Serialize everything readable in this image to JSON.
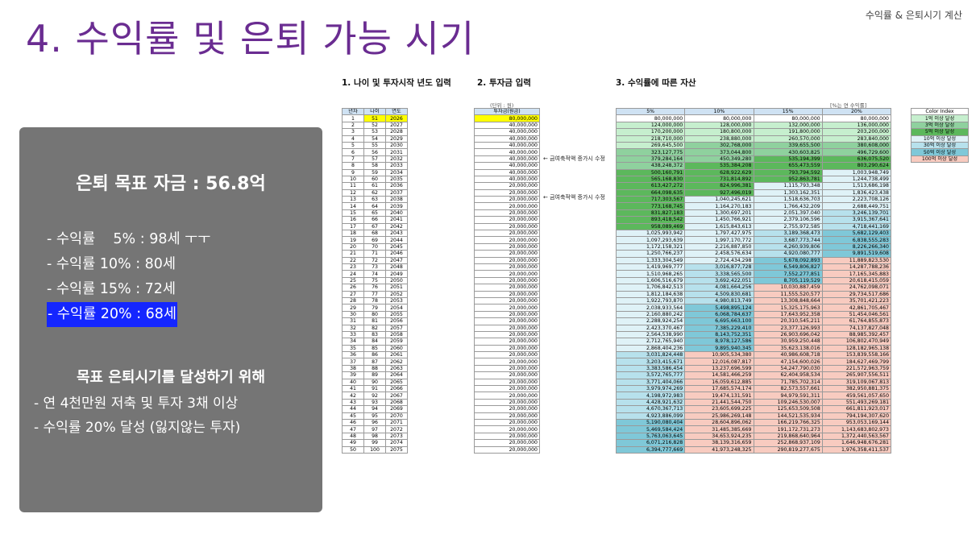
{
  "header": {
    "top_right_label": "수익률 & 은퇴시기 계산",
    "title": "4. 수익률 및 은퇴 가능 시기"
  },
  "panel": {
    "goal": "은퇴 목표 자금 : 56.8억",
    "rates": [
      "- 수익률    5% : 98세 ㅜㅜ",
      "- 수익률 10% : 80세",
      "- 수익률 15% : 72세",
      "- 수익률 20% : 68세"
    ],
    "selected_index": 3,
    "condition_title": "목표 은퇴시기를 달성하기 위해",
    "conditions": [
      "- 연 4천만원 저축 및 투자 3채 이상",
      "- 수익률 20% 달성 (잃지않는 투자)"
    ]
  },
  "sheet": {
    "section1_label": "1. 나이 및 투자시작 년도 입력",
    "section2_label": "2. 투자금 입력",
    "section3_label": "3. 수익률에 따른 자산",
    "unit_note": "(단위 : 원)",
    "rate_note": "[%는 연 수익률]",
    "change_note": "← 금여축적액 증가시 수정",
    "headers1": [
      "년차",
      "나이",
      "연도"
    ],
    "header2": "투자금(원금)",
    "headers3": [
      "5%",
      "10%",
      "15%",
      "20%"
    ],
    "legend_title": "Color Index",
    "legend": [
      {
        "label": "1억 이상 달성",
        "color": "#c6efce"
      },
      {
        "label": "3억 이상 달성",
        "color": "#8fd19e"
      },
      {
        "label": "5억 이상 달성",
        "color": "#5cb85c"
      },
      {
        "label": "10억 이상 달성",
        "color": "#dff2f7"
      },
      {
        "label": "30억 이상 달성",
        "color": "#b7e1ec"
      },
      {
        "label": "50억 이상 달성",
        "color": "#7fc8d8"
      },
      {
        "label": "100억 이상 달성",
        "color": "#f8cbc0"
      }
    ],
    "rows": [
      [
        "1",
        "51",
        "2026",
        "80,000,000",
        "80,000,000",
        "80,000,000",
        "80,000,000",
        "80,000,000"
      ],
      [
        "2",
        "52",
        "2027",
        "40,000,000",
        "124,000,000",
        "128,000,000",
        "132,000,000",
        "136,000,000"
      ],
      [
        "3",
        "53",
        "2028",
        "40,000,000",
        "170,200,000",
        "180,800,000",
        "191,800,000",
        "203,200,000"
      ],
      [
        "4",
        "54",
        "2029",
        "40,000,000",
        "218,710,000",
        "238,880,000",
        "260,570,000",
        "283,840,000"
      ],
      [
        "5",
        "55",
        "2030",
        "40,000,000",
        "269,645,500",
        "302,768,000",
        "339,655,500",
        "380,608,000"
      ],
      [
        "6",
        "56",
        "2031",
        "40,000,000",
        "323,127,775",
        "373,044,800",
        "430,603,825",
        "496,729,600"
      ],
      [
        "7",
        "57",
        "2032",
        "40,000,000",
        "379,284,164",
        "450,349,280",
        "535,194,399",
        "636,075,520"
      ],
      [
        "8",
        "58",
        "2033",
        "40,000,000",
        "438,248,372",
        "535,384,208",
        "655,473,559",
        "803,290,624"
      ],
      [
        "9",
        "59",
        "2034",
        "40,000,000",
        "500,160,791",
        "628,922,629",
        "793,794,592",
        "1,003,948,749"
      ],
      [
        "10",
        "60",
        "2035",
        "40,000,000",
        "565,168,830",
        "731,814,892",
        "952,863,781",
        "1,244,738,499"
      ],
      [
        "11",
        "61",
        "2036",
        "20,000,000",
        "613,427,272",
        "824,996,381",
        "1,115,793,348",
        "1,513,686,198"
      ],
      [
        "12",
        "62",
        "2037",
        "20,000,000",
        "664,098,635",
        "927,496,019",
        "1,303,162,351",
        "1,836,423,438"
      ],
      [
        "13",
        "63",
        "2038",
        "20,000,000",
        "717,303,567",
        "1,040,245,621",
        "1,518,636,703",
        "2,223,708,126"
      ],
      [
        "14",
        "64",
        "2039",
        "20,000,000",
        "773,168,745",
        "1,164,270,183",
        "1,766,432,209",
        "2,688,449,751"
      ],
      [
        "15",
        "65",
        "2040",
        "20,000,000",
        "831,827,183",
        "1,300,697,201",
        "2,051,397,040",
        "3,246,139,701"
      ],
      [
        "16",
        "66",
        "2041",
        "20,000,000",
        "893,418,542",
        "1,450,766,921",
        "2,379,106,596",
        "3,915,367,641"
      ],
      [
        "17",
        "67",
        "2042",
        "20,000,000",
        "958,089,469",
        "1,615,843,613",
        "2,755,972,585",
        "4,718,441,169"
      ],
      [
        "18",
        "68",
        "2043",
        "20,000,000",
        "1,025,993,942",
        "1,797,427,975",
        "3,189,368,473",
        "5,682,129,403"
      ],
      [
        "19",
        "69",
        "2044",
        "20,000,000",
        "1,097,293,639",
        "1,997,170,772",
        "3,687,773,744",
        "6,838,555,283"
      ],
      [
        "20",
        "70",
        "2045",
        "20,000,000",
        "1,172,158,321",
        "2,216,887,850",
        "4,260,939,806",
        "8,226,266,340"
      ],
      [
        "21",
        "71",
        "2046",
        "20,000,000",
        "1,250,766,237",
        "2,458,576,634",
        "4,920,080,777",
        "9,891,519,608"
      ],
      [
        "22",
        "72",
        "2047",
        "20,000,000",
        "1,333,304,549",
        "2,724,434,298",
        "5,678,092,893",
        "11,889,823,530"
      ],
      [
        "23",
        "73",
        "2048",
        "20,000,000",
        "1,419,969,777",
        "3,016,877,728",
        "6,549,806,827",
        "14,287,788,236"
      ],
      [
        "24",
        "74",
        "2049",
        "20,000,000",
        "1,510,968,265",
        "3,338,565,500",
        "7,552,277,851",
        "17,165,345,883"
      ],
      [
        "25",
        "75",
        "2050",
        "20,000,000",
        "1,606,516,679",
        "3,692,422,051",
        "8,705,119,529",
        "20,618,415,059"
      ],
      [
        "26",
        "76",
        "2051",
        "20,000,000",
        "1,706,842,513",
        "4,081,664,256",
        "10,030,887,459",
        "24,762,098,071"
      ],
      [
        "27",
        "77",
        "2052",
        "20,000,000",
        "1,812,184,638",
        "4,509,830,681",
        "11,555,520,577",
        "29,734,517,686"
      ],
      [
        "28",
        "78",
        "2053",
        "20,000,000",
        "1,922,793,870",
        "4,980,813,749",
        "13,308,848,664",
        "35,701,421,223"
      ],
      [
        "29",
        "79",
        "2054",
        "20,000,000",
        "2,038,933,564",
        "5,498,895,124",
        "15,325,175,963",
        "42,861,705,467"
      ],
      [
        "30",
        "80",
        "2055",
        "20,000,000",
        "2,160,880,242",
        "6,068,784,637",
        "17,643,952,358",
        "51,454,046,561"
      ],
      [
        "31",
        "81",
        "2056",
        "20,000,000",
        "2,288,924,254",
        "6,695,663,100",
        "20,310,545,211",
        "61,764,855,873"
      ],
      [
        "32",
        "82",
        "2057",
        "20,000,000",
        "2,423,370,467",
        "7,385,229,410",
        "23,377,126,993",
        "74,137,827,048"
      ],
      [
        "33",
        "83",
        "2058",
        "20,000,000",
        "2,564,538,990",
        "8,143,752,351",
        "26,903,696,042",
        "88,985,392,457"
      ],
      [
        "34",
        "84",
        "2059",
        "20,000,000",
        "2,712,765,940",
        "8,978,127,586",
        "30,959,250,448",
        "106,802,470,949"
      ],
      [
        "35",
        "85",
        "2060",
        "20,000,000",
        "2,868,404,236",
        "9,895,940,345",
        "35,623,138,016",
        "128,182,965,138"
      ],
      [
        "36",
        "86",
        "2061",
        "20,000,000",
        "3,031,824,448",
        "10,905,534,380",
        "40,986,608,718",
        "153,839,558,166"
      ],
      [
        "37",
        "87",
        "2062",
        "20,000,000",
        "3,203,415,671",
        "12,016,087,817",
        "47,154,600,026",
        "184,627,469,799"
      ],
      [
        "38",
        "88",
        "2063",
        "20,000,000",
        "3,383,586,454",
        "13,237,696,599",
        "54,247,790,030",
        "221,572,963,759"
      ],
      [
        "39",
        "89",
        "2064",
        "20,000,000",
        "3,572,765,777",
        "14,581,466,259",
        "62,404,958,534",
        "265,907,556,511"
      ],
      [
        "40",
        "90",
        "2065",
        "20,000,000",
        "3,771,404,066",
        "16,059,612,885",
        "71,785,702,314",
        "319,109,067,813"
      ],
      [
        "41",
        "91",
        "2066",
        "20,000,000",
        "3,979,974,269",
        "17,685,574,174",
        "82,573,557,661",
        "382,950,881,375"
      ],
      [
        "42",
        "92",
        "2067",
        "20,000,000",
        "4,198,972,983",
        "19,474,131,591",
        "94,979,591,311",
        "459,561,057,650"
      ],
      [
        "43",
        "93",
        "2068",
        "20,000,000",
        "4,428,921,632",
        "21,441,544,750",
        "109,246,530,007",
        "551,493,269,181"
      ],
      [
        "44",
        "94",
        "2069",
        "20,000,000",
        "4,670,367,713",
        "23,605,699,225",
        "125,653,509,508",
        "661,811,923,017"
      ],
      [
        "45",
        "95",
        "2070",
        "20,000,000",
        "4,923,886,099",
        "25,986,269,148",
        "144,521,535,934",
        "794,194,307,620"
      ],
      [
        "46",
        "96",
        "2071",
        "20,000,000",
        "5,190,080,404",
        "28,604,896,062",
        "166,219,766,325",
        "953,053,169,144"
      ],
      [
        "47",
        "97",
        "2072",
        "20,000,000",
        "5,469,584,424",
        "31,485,385,669",
        "191,172,731,273",
        "1,143,683,802,973"
      ],
      [
        "48",
        "98",
        "2073",
        "20,000,000",
        "5,763,063,645",
        "34,653,924,235",
        "219,868,640,964",
        "1,372,440,563,567"
      ],
      [
        "49",
        "99",
        "2074",
        "20,000,000",
        "6,071,216,828",
        "38,139,316,659",
        "252,868,937,109",
        "1,646,948,676,281"
      ],
      [
        "50",
        "100",
        "2075",
        "20,000,000",
        "6,394,777,669",
        "41,973,248,325",
        "290,819,277,675",
        "1,976,358,411,537"
      ]
    ]
  }
}
